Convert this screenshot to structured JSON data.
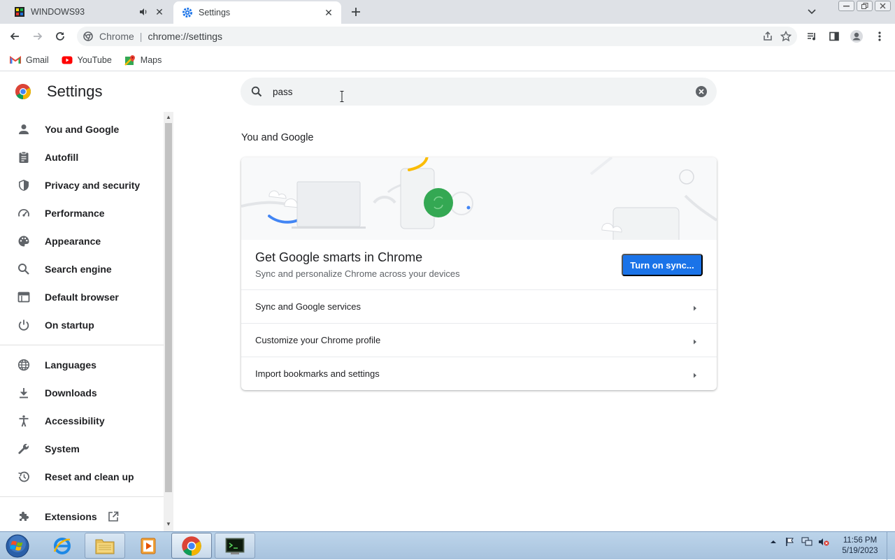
{
  "browser": {
    "tabs": [
      {
        "title": "WINDOWS93",
        "active": false,
        "audio": true
      },
      {
        "title": "Settings",
        "active": true
      }
    ],
    "address": {
      "site_name": "Chrome",
      "url": "chrome://settings"
    },
    "bookmarks": [
      {
        "label": "Gmail"
      },
      {
        "label": "YouTube"
      },
      {
        "label": "Maps"
      }
    ]
  },
  "settings": {
    "title": "Settings",
    "search": {
      "value": "pass",
      "placeholder": "Search settings"
    },
    "nav_primary": [
      {
        "label": "You and Google",
        "icon": "person-icon"
      },
      {
        "label": "Autofill",
        "icon": "clipboard-icon"
      },
      {
        "label": "Privacy and security",
        "icon": "shield-icon"
      },
      {
        "label": "Performance",
        "icon": "speedometer-icon"
      },
      {
        "label": "Appearance",
        "icon": "palette-icon"
      },
      {
        "label": "Search engine",
        "icon": "search-icon"
      },
      {
        "label": "Default browser",
        "icon": "browser-window-icon"
      },
      {
        "label": "On startup",
        "icon": "power-icon"
      }
    ],
    "nav_secondary": [
      {
        "label": "Languages",
        "icon": "globe-icon"
      },
      {
        "label": "Downloads",
        "icon": "download-icon"
      },
      {
        "label": "Accessibility",
        "icon": "accessibility-icon"
      },
      {
        "label": "System",
        "icon": "wrench-icon"
      },
      {
        "label": "Reset and clean up",
        "icon": "history-icon"
      }
    ],
    "nav_extensions": {
      "label": "Extensions",
      "icon": "puzzle-icon"
    },
    "section": {
      "title": "You and Google",
      "promo_title": "Get Google smarts in Chrome",
      "promo_subtitle": "Sync and personalize Chrome across your devices",
      "sync_button": "Turn on sync...",
      "rows": [
        {
          "label": "Sync and Google services"
        },
        {
          "label": "Customize your Chrome profile"
        },
        {
          "label": "Import bookmarks and settings"
        }
      ]
    }
  },
  "taskbar": {
    "clock_time": "11:56 PM",
    "clock_date": "5/19/2023"
  },
  "colors": {
    "accent": "#1a73e8",
    "tabstrip": "#dee1e6",
    "omnibox": "#f1f3f4"
  }
}
